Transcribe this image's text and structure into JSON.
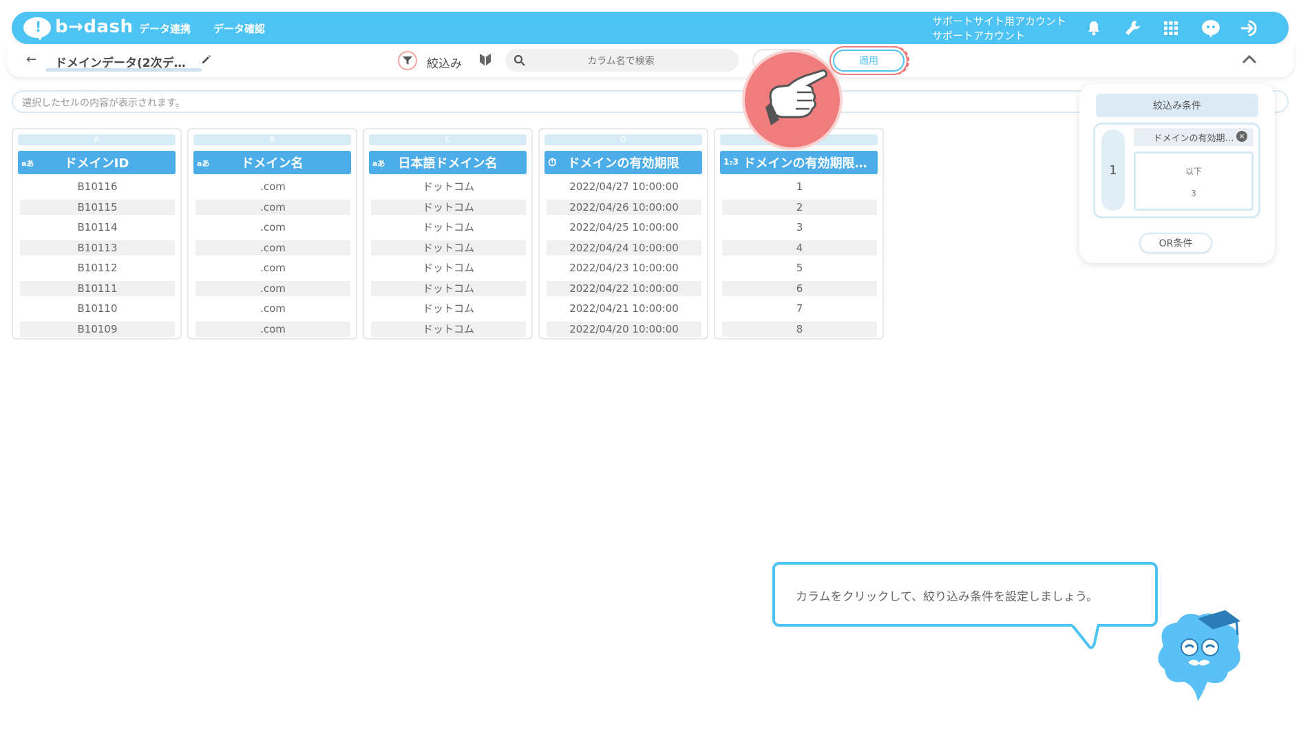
{
  "header": {
    "logo_text": "b→dash",
    "nav": [
      "データ連携",
      "データ確認"
    ],
    "account_line1": "サポートサイト用アカウント",
    "account_line2": "サポートアカウント",
    "icons": [
      "bell-icon",
      "wrench-icon",
      "apps-grid-icon",
      "mascot-icon",
      "logout-icon"
    ]
  },
  "toolbar": {
    "back_label": "←",
    "title": "ドメインデータ(2次デ…",
    "filter_label": "絞込み",
    "search_placeholder": "カラム名で検索",
    "apply_label": "適用"
  },
  "cell_preview": {
    "placeholder": "選択したセルの内容が表示されます。"
  },
  "columns": [
    {
      "letter": "A",
      "type": "aあ",
      "name": "ドメインID",
      "rows": [
        "B10116",
        "B10115",
        "B10114",
        "B10113",
        "B10112",
        "B10111",
        "B10110",
        "B10109"
      ]
    },
    {
      "letter": "B",
      "type": "aあ",
      "name": "ドメイン名",
      "rows": [
        ".com",
        ".com",
        ".com",
        ".com",
        ".com",
        ".com",
        ".com",
        ".com"
      ]
    },
    {
      "letter": "C",
      "type": "aあ",
      "name": "日本語ドメイン名",
      "rows": [
        "ドットコム",
        "ドットコム",
        "ドットコム",
        "ドットコム",
        "ドットコム",
        "ドットコム",
        "ドットコム",
        "ドットコム"
      ]
    },
    {
      "letter": "D",
      "type": "⏱",
      "name": "ドメインの有効期限",
      "rows": [
        "2022/04/27 10:00:00",
        "2022/04/26 10:00:00",
        "2022/04/25 10:00:00",
        "2022/04/24 10:00:00",
        "2022/04/23 10:00:00",
        "2022/04/22 10:00:00",
        "2022/04/21 10:00:00",
        "2022/04/20 10:00:00"
      ]
    },
    {
      "letter": "",
      "type": "1₂3",
      "name": "ドメインの有効期限…",
      "rows": [
        "1",
        "2",
        "3",
        "4",
        "5",
        "6",
        "7",
        "8"
      ]
    }
  ],
  "filter_panel": {
    "title": "絞込み条件",
    "group_index": "1",
    "condition_column": "ドメインの有効期…",
    "condition_operator": "以下",
    "condition_value": "3",
    "or_button": "OR条件"
  },
  "tutorial": {
    "message": "カラムをクリックして、絞り込み条件を設定しましょう。"
  },
  "colors": {
    "brand": "#4dc3f3",
    "column_header": "#4dade8",
    "highlight": "#ef7d7d"
  }
}
